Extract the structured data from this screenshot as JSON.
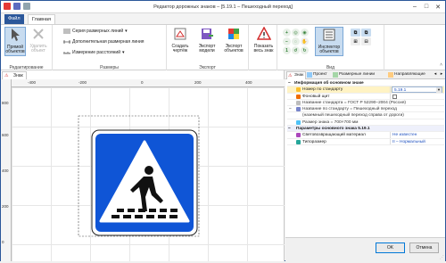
{
  "window": {
    "title": "Редактор дорожных знаков – [5.19.1 – Пешеходный переход]",
    "controls": [
      "–",
      "□",
      "✕"
    ]
  },
  "menu_tabs": [
    "Файл",
    "Главная"
  ],
  "ribbon": {
    "editing": {
      "label": "Редактирование",
      "select": "Прямой объектов",
      "delete": "Удалить объект"
    },
    "sizes": {
      "label": "Размеры",
      "series": "Серия размерных линий",
      "extra_line": "Дополнительная размерная линия",
      "measure": "Измерение расстояний"
    },
    "export": {
      "label": "Экспорт",
      "create": "Создать чертёж",
      "export_model": "Экспорт модели",
      "export_objects": "Экспорт объектов"
    },
    "show_all": "Показать весь знак",
    "view": {
      "label": "Вид",
      "inspector": "Инспектор объектов"
    }
  },
  "document": {
    "tab": "Знак",
    "ruler_h": [
      "-400",
      "-200",
      "0",
      "200",
      "400"
    ],
    "ruler_v": [
      "-400",
      "-200",
      "0",
      "200",
      "400",
      "600",
      "800"
    ]
  },
  "panel": {
    "tabs": [
      "Знак",
      "Проект",
      "Размерные линии",
      "Направляющие"
    ],
    "info_header": "Информация об основном знаке",
    "rows": [
      {
        "name": "Номер по стандарту",
        "value": "5.19.1"
      },
      {
        "name": "Фоновый щит",
        "value": ""
      },
      {
        "name": "Название стандарта = ГОСТ Р 52290–2004 (Россия)",
        "value": ""
      },
      {
        "name": "Название по стандарту = Пешеходный переход",
        "value": ""
      },
      {
        "name": "(наземный пешеходный переход справа от дороги)",
        "value": ""
      },
      {
        "name": "Размер знака = 700×700 мм",
        "value": ""
      }
    ],
    "params_header": "Параметры основного знака 5.19.1",
    "params": [
      {
        "name": "Световозвращающий материал",
        "value": "Не известен"
      },
      {
        "name": "Типоразмер",
        "value": "II – Нормальный"
      }
    ],
    "ok": "OK",
    "cancel": "Отмена"
  }
}
